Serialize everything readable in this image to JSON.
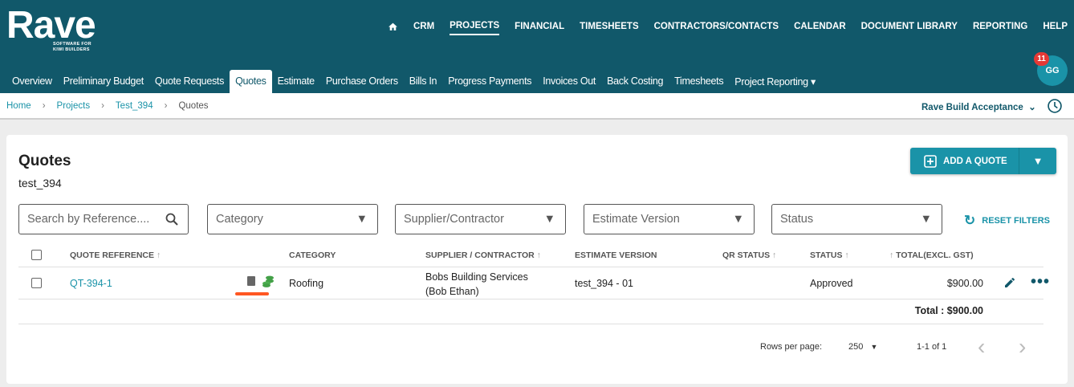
{
  "brand": {
    "name": "Rave",
    "tagline_1": "SOFTWARE FOR",
    "tagline_2": "KIWI BUILDERS"
  },
  "topnav": [
    "CRM",
    "PROJECTS",
    "FINANCIAL",
    "TIMESHEETS",
    "CONTRACTORS/CONTACTS",
    "CALENDAR",
    "DOCUMENT LIBRARY",
    "REPORTING",
    "HELP"
  ],
  "subnav": [
    "Overview",
    "Preliminary Budget",
    "Quote Requests",
    "Quotes",
    "Estimate",
    "Purchase Orders",
    "Bills In",
    "Progress Payments",
    "Invoices Out",
    "Back Costing",
    "Timesheets",
    "Project Reporting"
  ],
  "user": {
    "initials": "GG",
    "notifications": "11"
  },
  "breadcrumb": [
    "Home",
    "Projects",
    "Test_394",
    "Quotes"
  ],
  "org": "Rave Build Acceptance",
  "page": {
    "title": "Quotes",
    "subtitle": "test_394",
    "add_label": "ADD A QUOTE"
  },
  "filters": {
    "search_placeholder": "Search by Reference....",
    "category": "Category",
    "supplier": "Supplier/Contractor",
    "estimate": "Estimate Version",
    "status": "Status",
    "reset": "RESET FILTERS"
  },
  "columns": [
    "QUOTE REFERENCE",
    "CATEGORY",
    "SUPPLIER / CONTRACTOR",
    "ESTIMATE VERSION",
    "QR STATUS",
    "STATUS",
    "TOTAL(EXCL. GST)"
  ],
  "rows": [
    {
      "ref": "QT-394-1",
      "category": "Roofing",
      "supplier_1": "Bobs Building Services",
      "supplier_2": "(Bob Ethan)",
      "estimate": "test_394 - 01",
      "qr_status": "",
      "status": "Approved",
      "total": "$900.00"
    }
  ],
  "total": "Total : $900.00",
  "pagination": {
    "rows_label": "Rows per page:",
    "rows": "250",
    "range": "1-1 of 1"
  },
  "colors": {
    "header": "#11586a",
    "accent": "#1a93a8",
    "underline": "#ff5722"
  }
}
